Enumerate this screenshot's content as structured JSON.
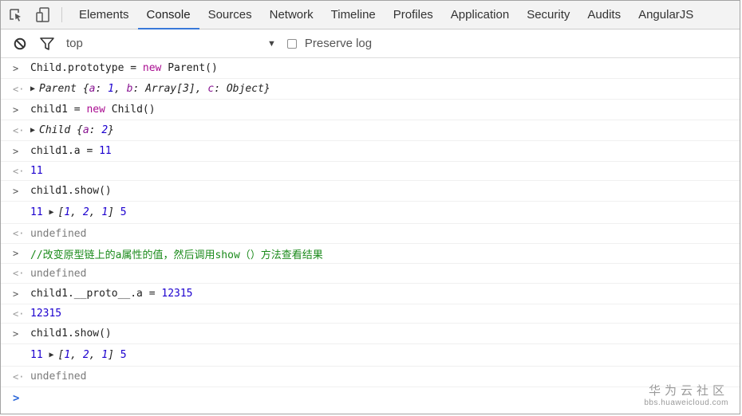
{
  "tabs": [
    "Elements",
    "Console",
    "Sources",
    "Network",
    "Timeline",
    "Profiles",
    "Application",
    "Security",
    "Audits",
    "AngularJS"
  ],
  "filter": {
    "context": "top",
    "preserve_log": "Preserve log"
  },
  "console": {
    "l1": {
      "a": "Child.prototype = ",
      "kw": "new",
      "b": " Parent()"
    },
    "l2": {
      "a": "Parent {",
      "k1": "a",
      "s1": ": ",
      "v1": "1",
      "s2": ", ",
      "k2": "b",
      "s3": ": Array[3], ",
      "k3": "c",
      "s4": ": Object}"
    },
    "l3": {
      "a": "child1 = ",
      "kw": "new",
      "b": " Child()"
    },
    "l4": {
      "a": "Child {",
      "k1": "a",
      "s1": ": ",
      "v1": "2",
      "s2": "}"
    },
    "l5": {
      "a": "child1.a = ",
      "v": "11"
    },
    "l6": {
      "v": "11"
    },
    "l7": {
      "a": "child1.show()"
    },
    "l8": {
      "v1": "11",
      "arr_a": "[",
      "n1": "1",
      "c1": ", ",
      "n2": "2",
      "c2": ", ",
      "n3": "1",
      "arr_b": "]",
      "v2": "5"
    },
    "l9": {
      "a": "undefined"
    },
    "l10": {
      "a": "//改变原型链上的a属性的值，然后调用show（）方法查看结果"
    },
    "l11": {
      "a": "undefined"
    },
    "l12": {
      "a": "child1.__proto__.a = ",
      "v": "12315"
    },
    "l13": {
      "v": "12315"
    },
    "l14": {
      "a": "child1.show()"
    },
    "l15": {
      "v1": "11",
      "arr_a": "[",
      "n1": "1",
      "c1": ", ",
      "n2": "2",
      "c2": ", ",
      "n3": "1",
      "arr_b": "]",
      "v2": "5"
    },
    "l16": {
      "a": "undefined"
    }
  },
  "watermark": {
    "line1": "华为云社区",
    "line2": "bbs.huaweicloud.com"
  },
  "colors": {
    "accent": "#3879d9",
    "keyword": "#aa0d91",
    "number": "#1c00cf",
    "comment": "#1a8a1a"
  }
}
